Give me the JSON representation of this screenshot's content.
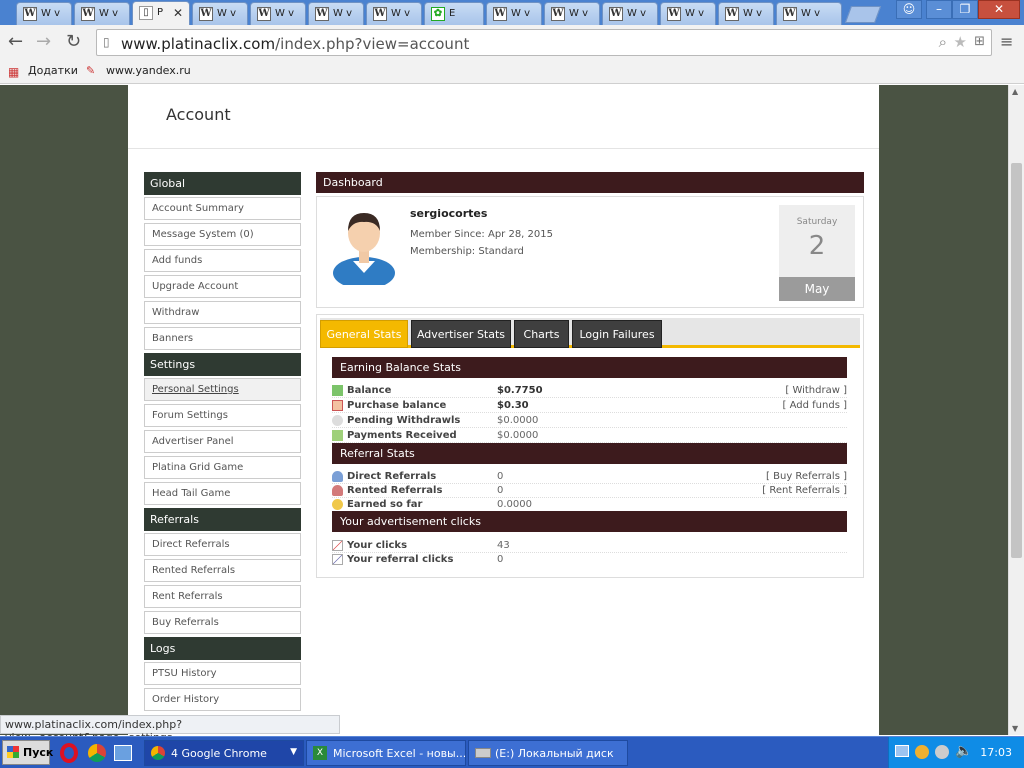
{
  "browser": {
    "tabs": [
      "W v",
      "W v",
      "P",
      "W v",
      "W v",
      "W v",
      "W v",
      "E",
      "W v",
      "W v",
      "W v",
      "W v",
      "W v",
      "W v"
    ],
    "address": {
      "domain": "www.platinaclix.com",
      "path": "/index.php?view=account"
    },
    "bookmarks": {
      "apps": "Додатки",
      "yandex": "www.yandex.ru"
    },
    "status_url": "www.platinaclix.com/index.php?view=account&page=settings"
  },
  "page": {
    "title": "Account",
    "sidebar": {
      "sections": [
        {
          "title": "Global",
          "items": [
            "Account Summary",
            "Message System (0)",
            "Add funds",
            "Upgrade Account",
            "Withdraw",
            "Banners"
          ]
        },
        {
          "title": "Settings",
          "items": [
            "Personal Settings",
            "Forum Settings",
            "Advertiser Panel",
            "Platina Grid Game",
            "Head Tail Game"
          ]
        },
        {
          "title": "Referrals",
          "items": [
            "Direct Referrals",
            "Rented Referrals",
            "Rent Referrals",
            "Buy Referrals"
          ]
        },
        {
          "title": "Logs",
          "items": [
            "PTSU History",
            "Order History"
          ]
        }
      ],
      "selected": "Personal Settings"
    },
    "dashboard": {
      "title": "Dashboard",
      "username": "sergiocortes",
      "member_since": "Member Since: Apr 28, 2015",
      "membership": "Membership: Standard",
      "date": {
        "weekday": "Saturday",
        "day": "2",
        "month": "May"
      }
    },
    "tabs": [
      "General Stats",
      "Advertiser Stats",
      "Charts",
      "Login Failures"
    ],
    "active_tab": "General Stats",
    "earning": {
      "title": "Earning Balance Stats",
      "rows": [
        {
          "label": "Balance",
          "value": "$0.7750",
          "action": "[ Withdraw ]"
        },
        {
          "label": "Purchase balance",
          "value": "$0.30",
          "action": "[ Add funds ]"
        },
        {
          "label": "Pending Withdrawls",
          "value": "$0.0000",
          "action": ""
        },
        {
          "label": "Payments Received",
          "value": "$0.0000",
          "action": ""
        }
      ]
    },
    "referral": {
      "title": "Referral Stats",
      "rows": [
        {
          "label": "Direct Referrals",
          "value": "0",
          "action": "[ Buy Referrals ]"
        },
        {
          "label": "Rented Referrals",
          "value": "0",
          "action": "[ Rent Referrals ]"
        },
        {
          "label": "Earned so far",
          "value": "0.0000",
          "action": ""
        }
      ]
    },
    "clicks": {
      "title": "Your advertisement clicks",
      "rows": [
        {
          "label": "Your clicks",
          "value": "43"
        },
        {
          "label": "Your referral clicks",
          "value": "0"
        }
      ]
    }
  },
  "taskbar": {
    "start": "Пуск",
    "items": [
      "4 Google Chrome",
      "Microsoft Excel - новы...",
      "(E:) Локальный диск"
    ],
    "clock": "17:03"
  },
  "colors": {
    "accent": "#f4b900",
    "sidebar_head": "#2f3a32",
    "section_head": "#3d1b1d",
    "page_bg": "#4a5343"
  }
}
